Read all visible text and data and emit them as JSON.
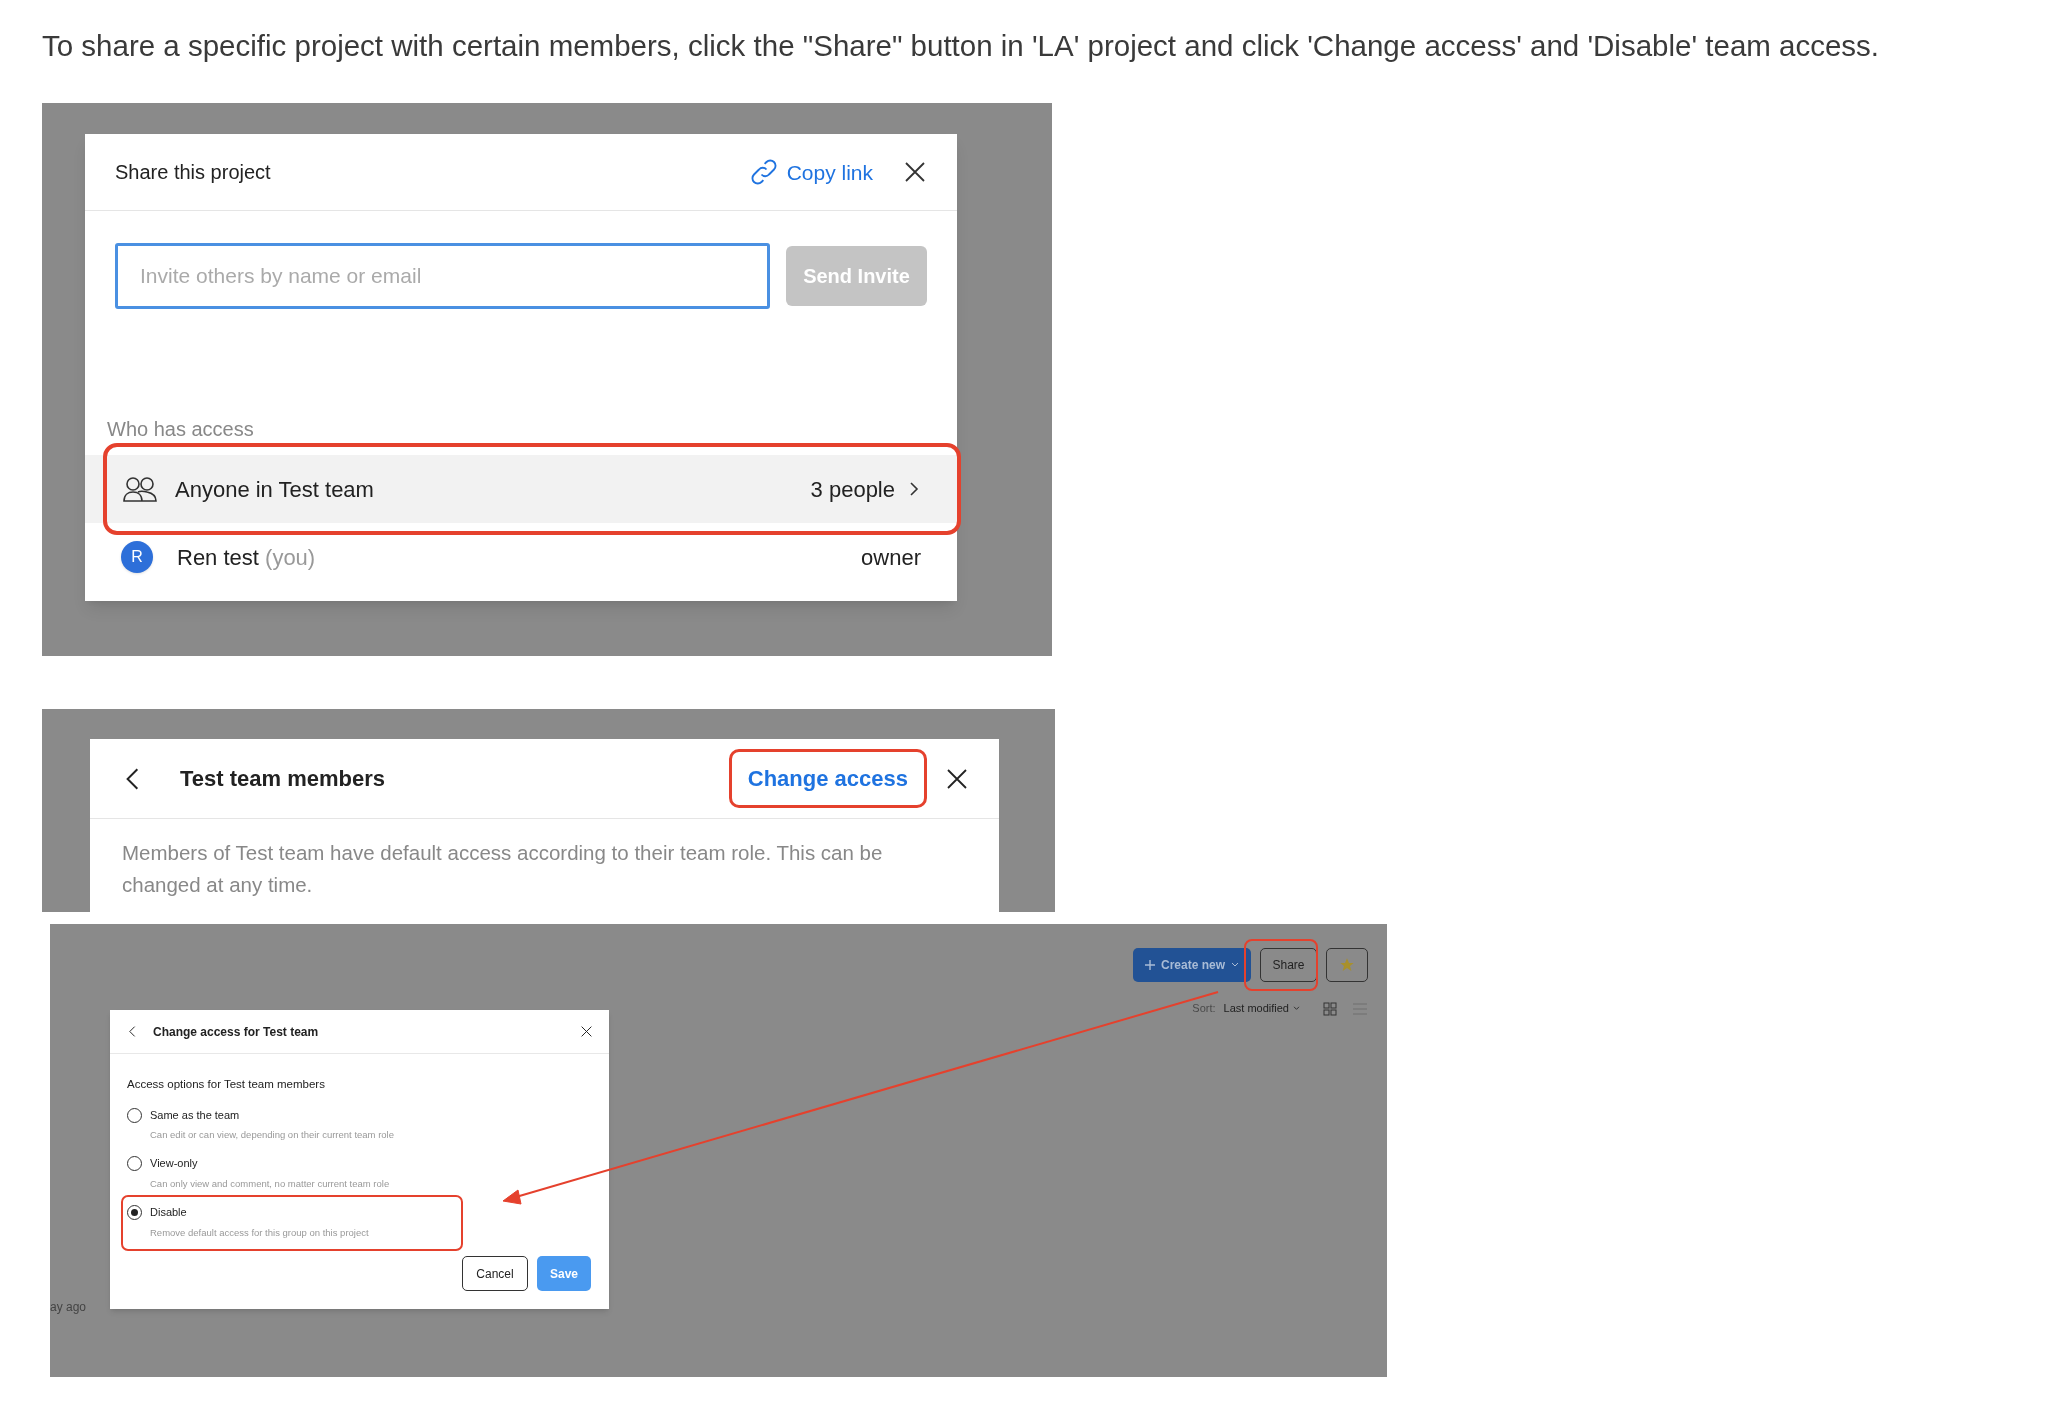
{
  "instruction": "To share a specific project with certain members, click the \"Share\" button in 'LA' project and click 'Change access' and 'Disable' team access.",
  "share_dialog": {
    "title": "Share this project",
    "copy_link": "Copy link",
    "invite_placeholder": "Invite others by name or email",
    "send_button": "Send Invite",
    "access_heading": "Who has access",
    "team_row": {
      "name": "Anyone in Test team",
      "count": "3 people",
      "highlighted": true
    },
    "member": {
      "avatar": "R",
      "name": "Ren test",
      "suffix": "(you)",
      "role": "owner"
    }
  },
  "members_dialog": {
    "title": "Test team members",
    "change_access": "Change access",
    "change_access_highlighted": true,
    "description": "Members of Test team have default access according to their team role. This can be changed at any time."
  },
  "toolbar": {
    "create_new": "Create new",
    "share": "Share",
    "share_highlighted": true,
    "sort_label": "Sort:",
    "sort_value": "Last modified",
    "timestamp": "ay ago"
  },
  "access_dialog": {
    "title": "Change access for Test team",
    "heading": "Access options for Test team members",
    "options": [
      {
        "label": "Same as the team",
        "description": "Can edit or can view, depending on their current team role",
        "selected": false,
        "highlighted": false
      },
      {
        "label": "View-only",
        "description": "Can only view and comment, no matter current team role",
        "selected": false,
        "highlighted": false
      },
      {
        "label": "Disable",
        "description": "Remove default access for this group on this project",
        "selected": true,
        "highlighted": true
      }
    ],
    "cancel": "Cancel",
    "save": "Save"
  }
}
